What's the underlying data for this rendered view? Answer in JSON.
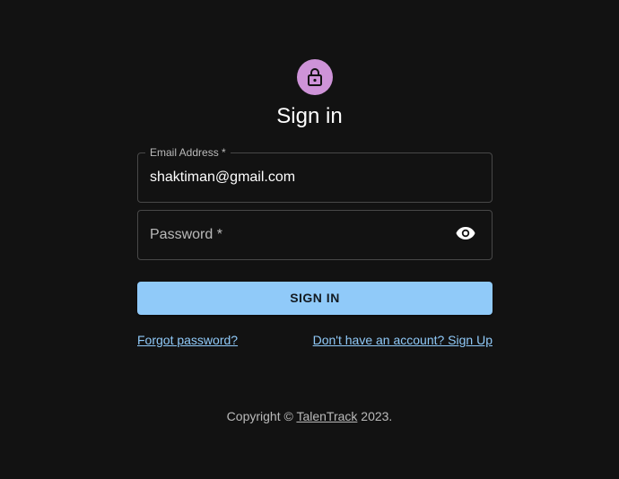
{
  "header": {
    "avatar_icon": "lock-icon",
    "avatar_color": "#ce93d8",
    "title": "Sign in"
  },
  "form": {
    "email": {
      "label": "Email Address",
      "required_mark": " *",
      "value": "shaktiman@gmail.com"
    },
    "password": {
      "label": "Password",
      "required_mark": " *",
      "value": "",
      "toggle_icon": "eye-icon"
    },
    "submit_label": "SIGN IN",
    "submit_color": "#90caf9"
  },
  "links": {
    "forgot": "Forgot password?",
    "signup": "Don't have an account? Sign Up",
    "link_color": "#90caf9"
  },
  "footer": {
    "prefix": "Copyright © ",
    "brand": "TalenTrack",
    "suffix": " 2023."
  }
}
